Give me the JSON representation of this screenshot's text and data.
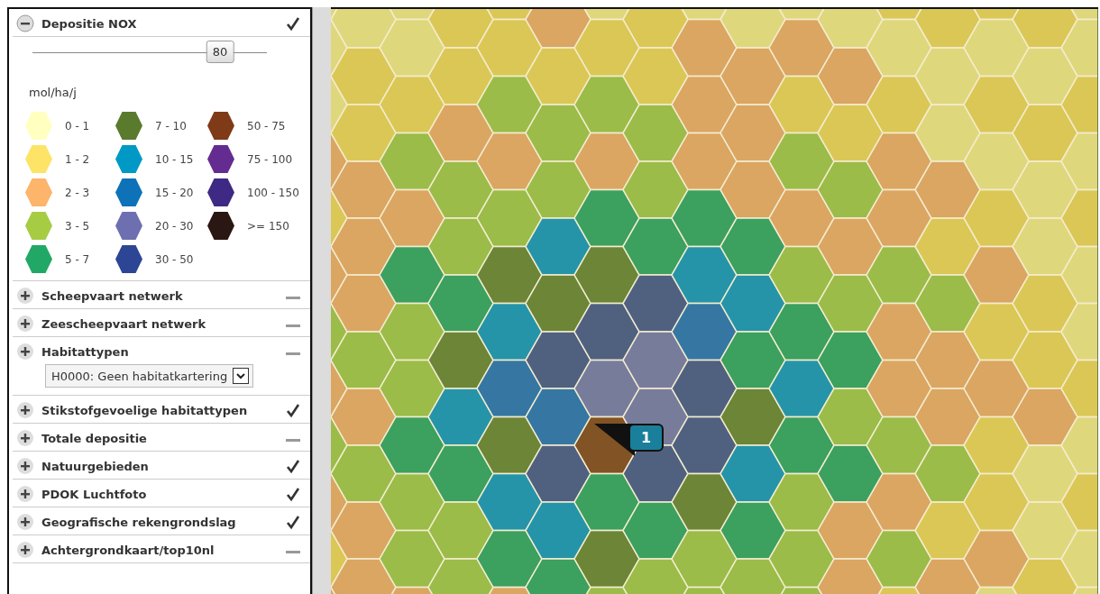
{
  "layers": [
    {
      "label": "Depositie NOX",
      "expanded": true,
      "visible": true,
      "slider": {
        "level": 0.8,
        "reading": "80"
      },
      "unit": "mol/ha/j",
      "legend": [
        {
          "label": "0 - 1",
          "color": "#ffffbf"
        },
        {
          "label": "1 - 2",
          "color": "#fde466"
        },
        {
          "label": "2 - 3",
          "color": "#fdb46b"
        },
        {
          "label": "3 - 5",
          "color": "#a6cc44"
        },
        {
          "label": "5 - 7",
          "color": "#22a866"
        },
        {
          "label": "7 - 10",
          "color": "#5a7a2e"
        },
        {
          "label": "10 - 15",
          "color": "#0099c6"
        },
        {
          "label": "15 - 20",
          "color": "#0e72b8"
        },
        {
          "label": "20 - 30",
          "color": "#6d6fb0"
        },
        {
          "label": "30 - 50",
          "color": "#2d4595"
        },
        {
          "label": "50 - 75",
          "color": "#7f3a17"
        },
        {
          "label": "75 - 100",
          "color": "#642c91"
        },
        {
          "label": "100 - 150",
          "color": "#3e2a84"
        },
        {
          "label": ">= 150",
          "color": "#2a1612"
        }
      ]
    },
    {
      "label": "Scheepvaart netwerk",
      "expanded": false,
      "visible": false
    },
    {
      "label": "Zeescheepvaart netwerk",
      "expanded": false,
      "visible": false
    },
    {
      "label": "Habitattypen",
      "expanded": false,
      "visible": false,
      "dropdown": "H0000: Geen habitatkartering"
    },
    {
      "label": "Stikstofgevoelige habitattypen",
      "expanded": false,
      "visible": true
    },
    {
      "label": "Totale depositie",
      "expanded": false,
      "visible": false
    },
    {
      "label": "Natuurgebieden",
      "expanded": false,
      "visible": true
    },
    {
      "label": "PDOK Luchtfoto",
      "expanded": false,
      "visible": true
    },
    {
      "label": "Geografische rekengrondslag",
      "expanded": false,
      "visible": true
    },
    {
      "label": "Achtergrondkaart/top10nl",
      "expanded": false,
      "visible": false
    }
  ],
  "map": {
    "marker": "1"
  }
}
